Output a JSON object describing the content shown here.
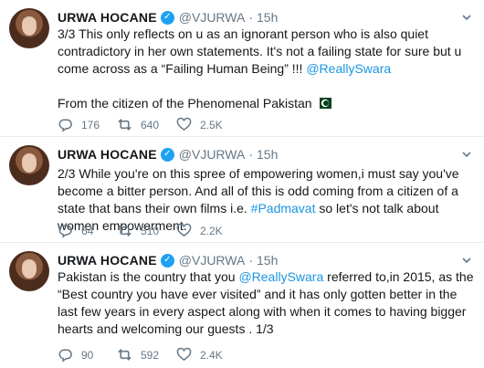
{
  "tweets": [
    {
      "name": "URWA HOCANE",
      "verified_glyph": "✓",
      "handle": "@VJURWA",
      "separator": "·",
      "time": "15h",
      "text_a": "3/3 This only reflects on u as an ignorant person who is also quiet contradictory in her own statements. It's not a failing state for sure but u come across as a “Failing Human Being” !!! ",
      "mention": "@ReallySwara",
      "text_b": "From the citizen of the Phenomenal Pakistan",
      "flag_icon": "pakistan-flag-icon",
      "replies": "176",
      "retweets": "640",
      "likes": "2.5K"
    },
    {
      "name": "URWA HOCANE",
      "verified_glyph": "✓",
      "handle": "@VJURWA",
      "separator": "·",
      "time": "15h",
      "text_a": "2/3 While you're on this spree of empowering women,i must say you've become a bitter person. And all of this is odd coming from a citizen of a state that bans their own films i.e. ",
      "hashtag": "#Padmavat",
      "text_b": " so let's not talk about women empowerment.",
      "replies": "64",
      "retweets": "510",
      "likes": "2.2K"
    },
    {
      "name": "URWA HOCANE",
      "verified_glyph": "✓",
      "handle": "@VJURWA",
      "separator": "·",
      "time": "15h",
      "text_a": "Pakistan is the country that you ",
      "mention": "@ReallySwara",
      "text_b": " referred to,in 2015, as the “Best country you have ever visited” and it has only gotten better in the last few years in every aspect  along with when it comes to having bigger hearts and welcoming our guests . 1/3",
      "replies": "90",
      "retweets": "592",
      "likes": "2.4K"
    }
  ],
  "icons": {
    "reply": "reply-icon",
    "retweet": "retweet-icon",
    "like": "heart-icon",
    "menu": "chevron-down-icon",
    "verified": "verified-badge-icon"
  },
  "colors": {
    "link": "#1b95e0",
    "verified": "#1da1f2",
    "muted": "#657786",
    "text": "#14171a"
  }
}
